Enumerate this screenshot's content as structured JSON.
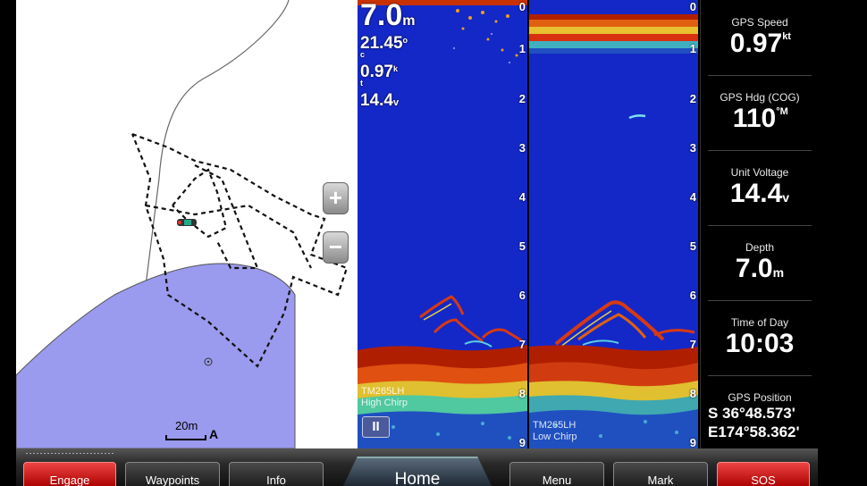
{
  "map": {
    "zoom_in_label": "+",
    "zoom_out_label": "−",
    "scale_label": "20m",
    "north_label": "A"
  },
  "sonar_readout": {
    "depth_value": "7.0",
    "depth_unit": "m",
    "water_temp_value": "21.45",
    "water_temp_unit_top": "o",
    "water_temp_unit_bottom": "c",
    "speed_value": "0.97",
    "speed_unit_top": "k",
    "speed_unit_bottom": "t",
    "voltage_value": "14.4",
    "voltage_unit": "v"
  },
  "sonar_high": {
    "freq_line1": "TM265LH",
    "freq_line2": "High Chirp",
    "pause_label": "II"
  },
  "sonar_low": {
    "freq_line1": "TM265LH",
    "freq_line2": "Low Chirp"
  },
  "depth_scale": [
    "0",
    "1",
    "2",
    "3",
    "4",
    "5",
    "6",
    "7",
    "8",
    "9"
  ],
  "data_fields": [
    {
      "title": "GPS Speed",
      "value": "0.97",
      "unit": "kt"
    },
    {
      "title": "GPS Hdg (COG)",
      "value": "110",
      "unit": "°M"
    },
    {
      "title": "Unit Voltage",
      "value": "14.4",
      "unit": "v"
    },
    {
      "title": "Depth",
      "value": "7.0",
      "unit": "m"
    },
    {
      "title": "Time of Day",
      "value": "10:03",
      "unit": ""
    }
  ],
  "gps_position": {
    "title": "GPS Position",
    "lat": "S  36°48.573'",
    "lon": "E174°58.362'"
  },
  "softkeys": {
    "engage": "Engage",
    "waypoints": "Waypoints",
    "info": "Info",
    "home": "Home",
    "menu": "Menu",
    "mark": "Mark",
    "sos": "SOS"
  },
  "colors": {
    "water_blue": "#1428c8",
    "land_lilac": "#9a9aee",
    "sos_red": "#cc1111"
  }
}
